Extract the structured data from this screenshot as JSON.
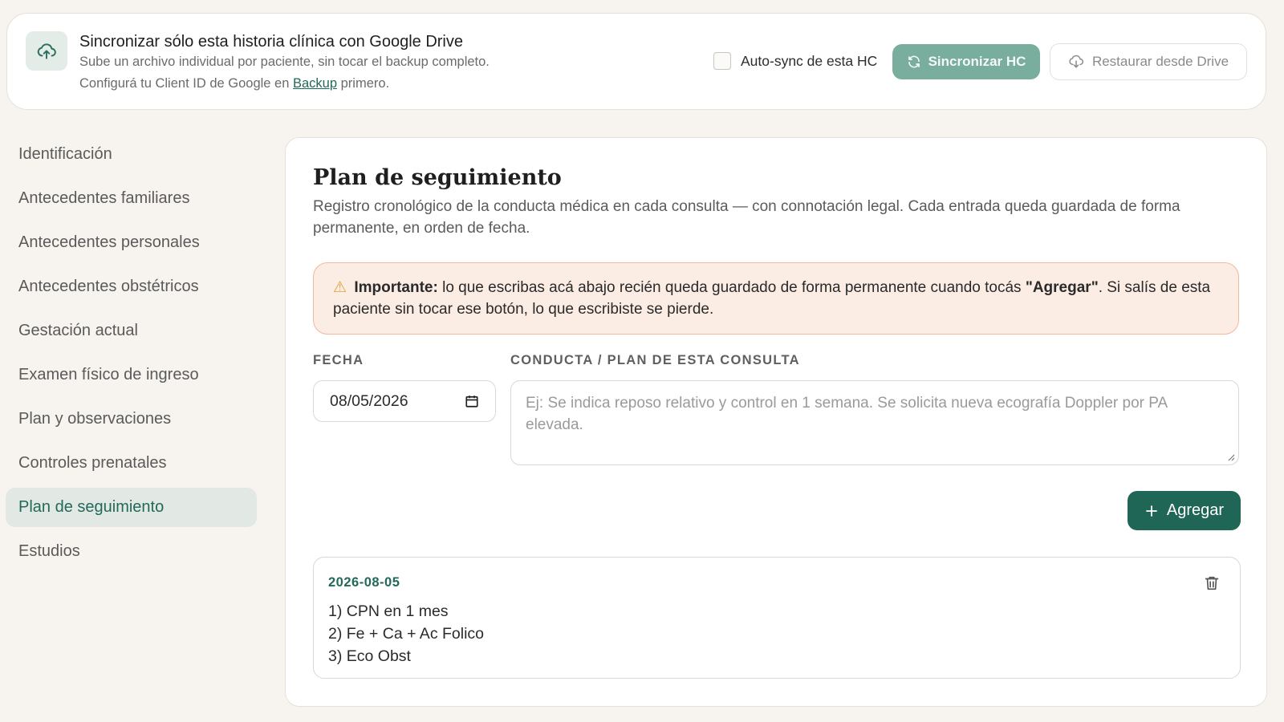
{
  "sync": {
    "title": "Sincronizar sólo esta historia clínica con Google Drive",
    "subtitle": "Sube un archivo individual por paciente, sin tocar el backup completo.",
    "note_prefix": "Configurá tu Client ID de Google en ",
    "note_link": "Backup",
    "note_suffix": " primero.",
    "autosync_label": "Auto-sync de esta HC",
    "autosync_checked": false,
    "sync_button": "Sincronizar HC",
    "restore_button": "Restaurar desde Drive"
  },
  "sidebar": {
    "items": [
      {
        "label": "Identificación",
        "active": false
      },
      {
        "label": "Antecedentes familiares",
        "active": false
      },
      {
        "label": "Antecedentes personales",
        "active": false
      },
      {
        "label": "Antecedentes obstétricos",
        "active": false
      },
      {
        "label": "Gestación actual",
        "active": false
      },
      {
        "label": "Examen físico de ingreso",
        "active": false
      },
      {
        "label": "Plan y observaciones",
        "active": false
      },
      {
        "label": "Controles prenatales",
        "active": false
      },
      {
        "label": "Plan de seguimiento",
        "active": true
      },
      {
        "label": "Estudios",
        "active": false
      }
    ]
  },
  "main": {
    "title": "Plan de seguimiento",
    "description": "Registro cronológico de la conducta médica en cada consulta — con connotación legal. Cada entrada queda guardada de forma permanente, en orden de fecha.",
    "alert": {
      "icon": "⚠",
      "strong": "Importante:",
      "text_a": " lo que escribas acá abajo recién queda guardado de forma permanente cuando tocás ",
      "strong_b": "\"Agregar\"",
      "text_b": ". Si salís de esta paciente sin tocar ese botón, lo que escribiste se pierde."
    },
    "date_label": "Fecha",
    "date_value": "08/05/2026",
    "conduct_label": "Conducta / plan de esta consulta",
    "conduct_placeholder": "Ej: Se indica reposo relativo y control en 1 semana. Se solicita nueva ecografía Doppler por PA elevada.",
    "add_button": "Agregar",
    "entries": [
      {
        "date": "2026-08-05",
        "lines": [
          "1) CPN en 1 mes",
          "2) Fe + Ca + Ac Folico",
          "3) Eco Obst"
        ]
      }
    ]
  },
  "colors": {
    "accent": "#1f6656",
    "accent_light": "#79ad9e",
    "alert_bg": "#fbede4",
    "alert_border": "#f0b99b"
  }
}
